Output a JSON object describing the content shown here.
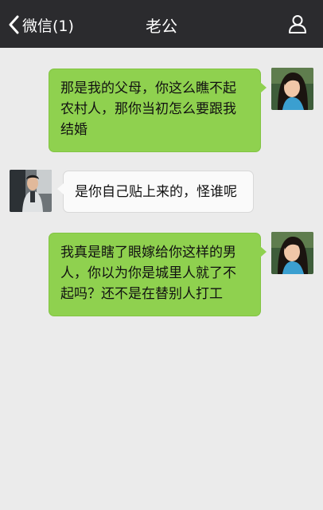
{
  "header": {
    "back_label": "微信(1)",
    "title": "老公",
    "back_icon": "chevron-left-icon",
    "profile_icon": "person-icon"
  },
  "messages": [
    {
      "side": "right",
      "sender": "me",
      "text": "那是我的父母，你这么瞧不起农村人，那你当初怎么要跟我结婚"
    },
    {
      "side": "left",
      "sender": "husband",
      "text": "是你自己贴上来的，怪谁呢"
    },
    {
      "side": "right",
      "sender": "me",
      "text": "我真是瞎了眼嫁给你这样的男人，你以为你是城里人就了不起吗？还不是在替别人打工"
    }
  ],
  "colors": {
    "header_bg": "#2b2b2e",
    "chat_bg": "#ebebeb",
    "outgoing_bubble": "#8fd14f",
    "incoming_bubble": "#fafafa"
  }
}
